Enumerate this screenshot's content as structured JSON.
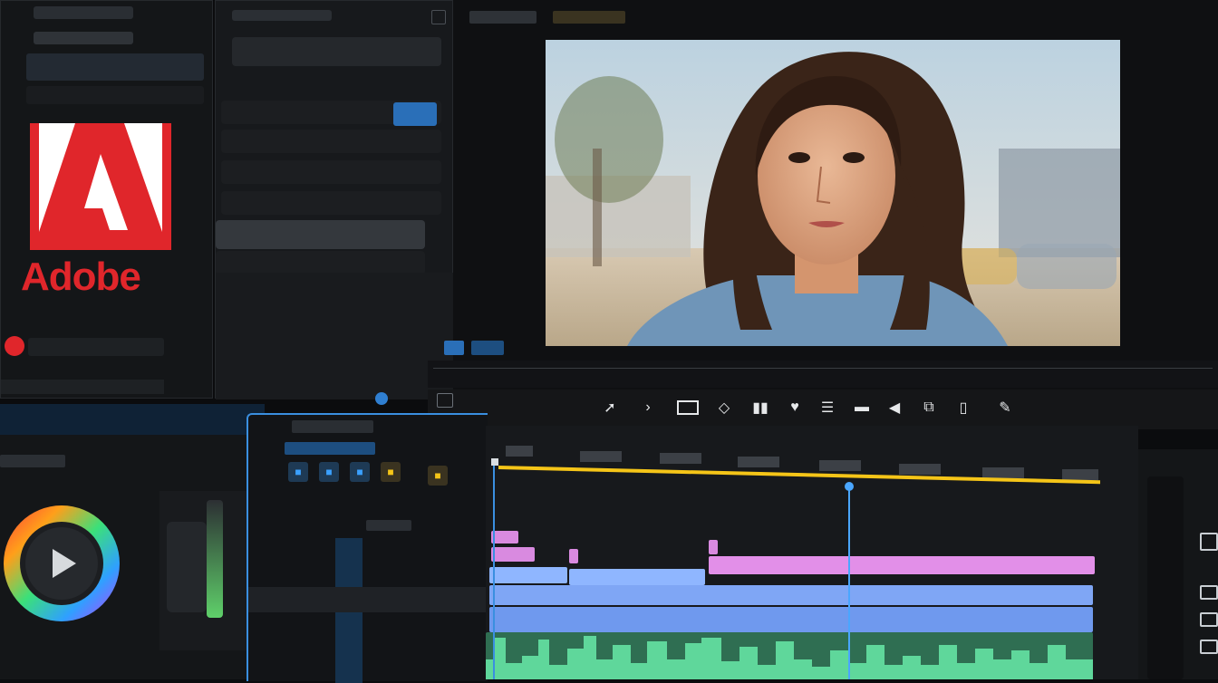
{
  "brand": {
    "name": "Adobe",
    "color": "#e0262b"
  },
  "left_panel": {
    "rows": [
      "",
      "",
      "",
      "",
      "",
      "",
      ""
    ],
    "record_icon": "record-icon"
  },
  "viewer": {
    "tabs": [
      "",
      "",
      ""
    ],
    "zoom_label": ""
  },
  "timeline": {
    "ruler_labels": [
      "",
      "",
      "",
      "",
      "",
      "",
      "",
      ""
    ],
    "playhead_color": "#4aa6ff",
    "work_area_color": "#f5c518"
  },
  "color_panel": {
    "wheel_icon": "play-icon"
  },
  "colors": {
    "accent": "#3aa0ff",
    "pink_clip": "#e28fe8",
    "blue_clip": "#8fb6ff",
    "green_audio": "#5fd79b"
  },
  "transport_tools": [
    "selection-tool-icon",
    "forward-icon",
    "rectangle-icon",
    "shape-icon",
    "bars-icon",
    "heart-icon",
    "list-icon",
    "flag-icon",
    "rewind-icon",
    "clipboard-icon",
    "page-icon",
    "pen-icon"
  ]
}
